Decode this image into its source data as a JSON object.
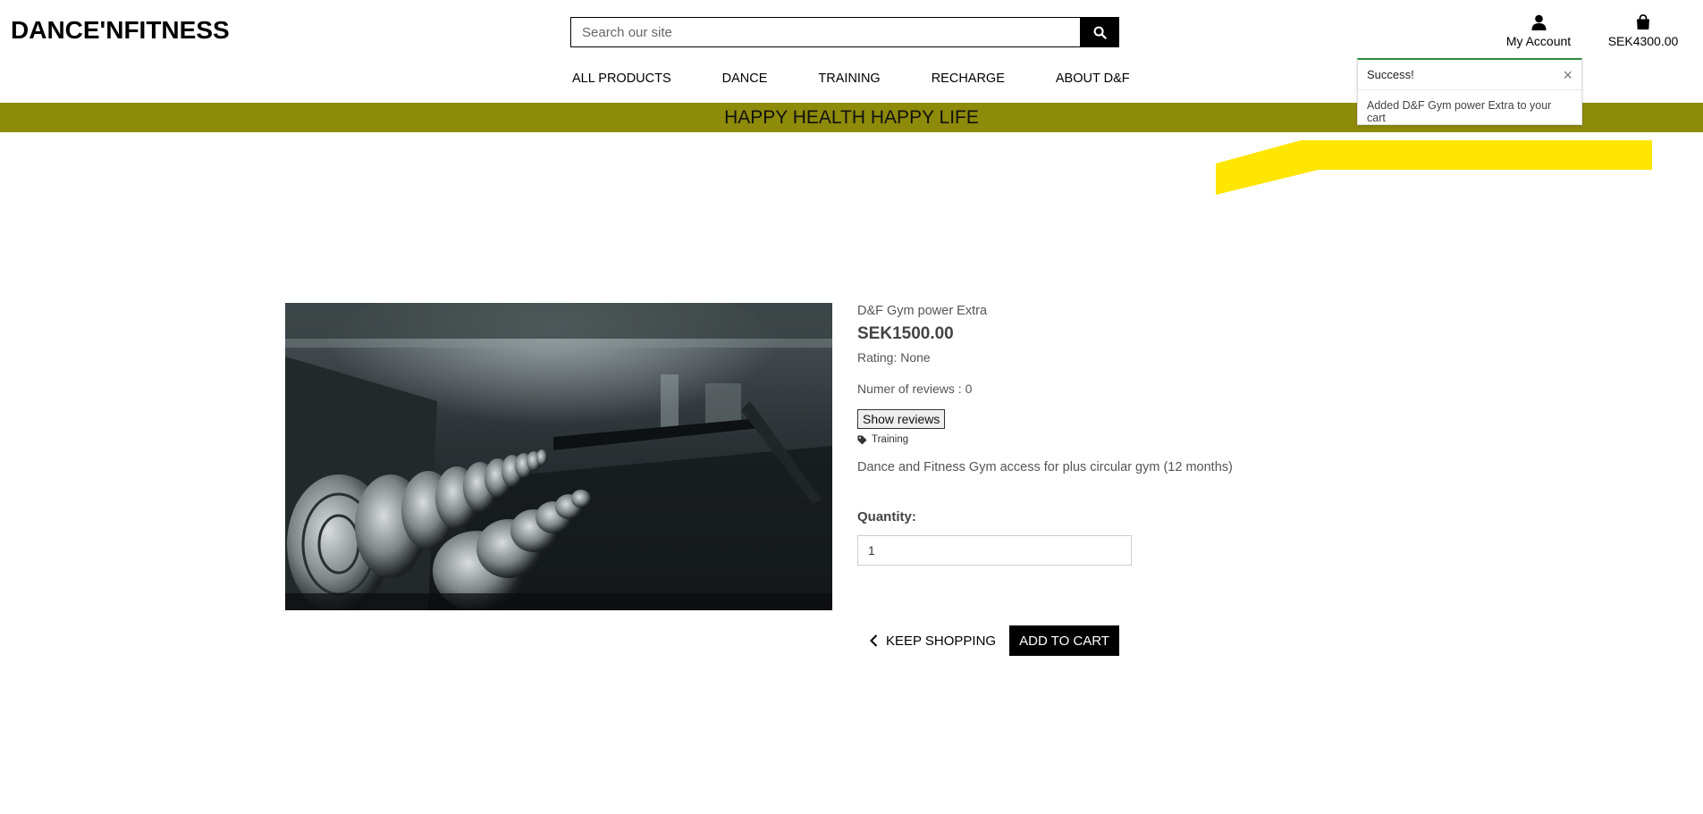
{
  "header": {
    "logo": "DANCE'NFITNESS",
    "search": {
      "placeholder": "Search our site",
      "value": ""
    },
    "account_label": "My Account",
    "cart_total": "SEK4300.00"
  },
  "nav": {
    "items": [
      {
        "label": "ALL PRODUCTS"
      },
      {
        "label": "DANCE"
      },
      {
        "label": "TRAINING"
      },
      {
        "label": "RECHARGE"
      },
      {
        "label": "ABOUT D&F"
      }
    ]
  },
  "banner": {
    "text": "HAPPY HEALTH HAPPY LIFE"
  },
  "toast": {
    "title": "Success!",
    "message": "Added D&F Gym power Extra to your cart",
    "close_symbol": "×"
  },
  "product": {
    "name": "D&F Gym power Extra",
    "price": "SEK1500.00",
    "rating": "Rating: None",
    "reviews_count": "Numer of reviews : 0",
    "show_reviews_label": "Show reviews",
    "category": "Training",
    "description": "Dance and Fitness Gym access for plus circular gym (12 months)",
    "quantity_label": "Quantity:",
    "quantity_value": "1"
  },
  "actions": {
    "keep_shopping_label": "KEEP SHOPPING",
    "add_to_cart_label": "ADD TO CART"
  },
  "colors": {
    "banner": "#8e8a0a",
    "highlight": "#ffe600",
    "toast_accent": "#2e8b3a"
  }
}
